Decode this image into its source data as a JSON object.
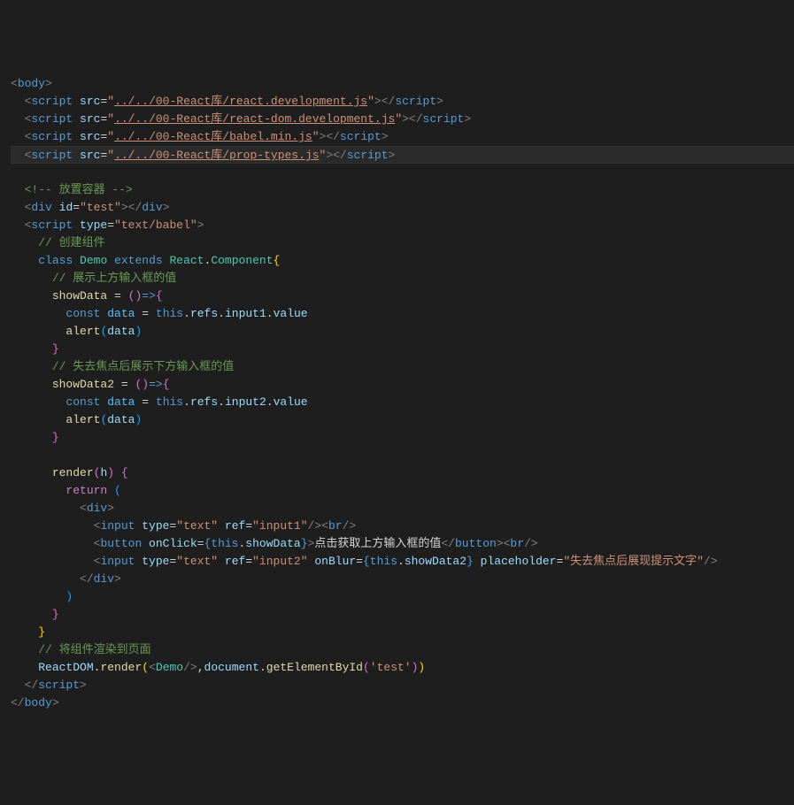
{
  "lines": [
    {
      "segments": [
        {
          "c": "gray",
          "t": "<"
        },
        {
          "c": "tag",
          "t": "body"
        },
        {
          "c": "gray",
          "t": ">"
        }
      ]
    },
    {
      "segments": [
        {
          "c": "punct",
          "t": "  "
        },
        {
          "c": "gray",
          "t": "<"
        },
        {
          "c": "tag",
          "t": "script "
        },
        {
          "c": "attr",
          "t": "src"
        },
        {
          "c": "op",
          "t": "="
        },
        {
          "c": "str",
          "t": "\""
        },
        {
          "c": "str-u",
          "t": "../../00-React库/react.development.js"
        },
        {
          "c": "str",
          "t": "\""
        },
        {
          "c": "gray",
          "t": "></"
        },
        {
          "c": "tag",
          "t": "script"
        },
        {
          "c": "gray",
          "t": ">"
        }
      ]
    },
    {
      "segments": [
        {
          "c": "punct",
          "t": "  "
        },
        {
          "c": "gray",
          "t": "<"
        },
        {
          "c": "tag",
          "t": "script "
        },
        {
          "c": "attr",
          "t": "src"
        },
        {
          "c": "op",
          "t": "="
        },
        {
          "c": "str",
          "t": "\""
        },
        {
          "c": "str-u",
          "t": "../../00-React库/react-dom.development.js"
        },
        {
          "c": "str",
          "t": "\""
        },
        {
          "c": "gray",
          "t": "></"
        },
        {
          "c": "tag",
          "t": "script"
        },
        {
          "c": "gray",
          "t": ">"
        }
      ]
    },
    {
      "segments": [
        {
          "c": "punct",
          "t": "  "
        },
        {
          "c": "gray",
          "t": "<"
        },
        {
          "c": "tag",
          "t": "script "
        },
        {
          "c": "attr",
          "t": "src"
        },
        {
          "c": "op",
          "t": "="
        },
        {
          "c": "str",
          "t": "\""
        },
        {
          "c": "str-u",
          "t": "../../00-React库/babel.min.js"
        },
        {
          "c": "str",
          "t": "\""
        },
        {
          "c": "gray",
          "t": "></"
        },
        {
          "c": "tag",
          "t": "script"
        },
        {
          "c": "gray",
          "t": ">"
        }
      ]
    },
    {
      "highlighted": true,
      "segments": [
        {
          "c": "punct",
          "t": "  "
        },
        {
          "c": "gray",
          "t": "<"
        },
        {
          "c": "tag",
          "t": "script "
        },
        {
          "c": "attr",
          "t": "src"
        },
        {
          "c": "op",
          "t": "="
        },
        {
          "c": "str",
          "t": "\""
        },
        {
          "c": "str-u",
          "t": "../../00-React库/prop-types.js"
        },
        {
          "c": "str",
          "t": "\""
        },
        {
          "c": "gray",
          "t": "></"
        },
        {
          "c": "tag",
          "t": "script"
        },
        {
          "c": "gray",
          "t": ">"
        }
      ]
    },
    {
      "segments": []
    },
    {
      "segments": [
        {
          "c": "punct",
          "t": "  "
        },
        {
          "c": "comment-green",
          "t": "<!-- 放置容器 -->"
        }
      ]
    },
    {
      "segments": [
        {
          "c": "punct",
          "t": "  "
        },
        {
          "c": "gray",
          "t": "<"
        },
        {
          "c": "tag",
          "t": "div "
        },
        {
          "c": "attr",
          "t": "id"
        },
        {
          "c": "op",
          "t": "="
        },
        {
          "c": "str",
          "t": "\"test\""
        },
        {
          "c": "gray",
          "t": "></"
        },
        {
          "c": "tag",
          "t": "div"
        },
        {
          "c": "gray",
          "t": ">"
        }
      ]
    },
    {
      "segments": [
        {
          "c": "punct",
          "t": "  "
        },
        {
          "c": "gray",
          "t": "<"
        },
        {
          "c": "tag",
          "t": "script "
        },
        {
          "c": "attr",
          "t": "type"
        },
        {
          "c": "op",
          "t": "="
        },
        {
          "c": "str",
          "t": "\"text/babel\""
        },
        {
          "c": "gray",
          "t": ">"
        }
      ]
    },
    {
      "segments": [
        {
          "c": "punct",
          "t": "    "
        },
        {
          "c": "comment-green",
          "t": "// 创建组件"
        }
      ]
    },
    {
      "segments": [
        {
          "c": "punct",
          "t": "    "
        },
        {
          "c": "keyword-blue",
          "t": "class"
        },
        {
          "c": "punct",
          "t": " "
        },
        {
          "c": "class-name",
          "t": "Demo"
        },
        {
          "c": "punct",
          "t": " "
        },
        {
          "c": "keyword-blue",
          "t": "extends"
        },
        {
          "c": "punct",
          "t": " "
        },
        {
          "c": "class-name",
          "t": "React"
        },
        {
          "c": "punct",
          "t": "."
        },
        {
          "c": "class-name",
          "t": "Component"
        },
        {
          "c": "brace",
          "t": "{"
        }
      ]
    },
    {
      "segments": [
        {
          "c": "punct",
          "t": "      "
        },
        {
          "c": "comment-green",
          "t": "// 展示上方输入框的值"
        }
      ]
    },
    {
      "segments": [
        {
          "c": "punct",
          "t": "      "
        },
        {
          "c": "fn",
          "t": "showData"
        },
        {
          "c": "punct",
          "t": " "
        },
        {
          "c": "op",
          "t": "="
        },
        {
          "c": "punct",
          "t": " "
        },
        {
          "c": "brace-purple",
          "t": "()"
        },
        {
          "c": "keyword-blue",
          "t": "=>"
        },
        {
          "c": "brace-purple",
          "t": "{"
        }
      ]
    },
    {
      "segments": [
        {
          "c": "punct",
          "t": "        "
        },
        {
          "c": "keyword-blue",
          "t": "const"
        },
        {
          "c": "punct",
          "t": " "
        },
        {
          "c": "const",
          "t": "data"
        },
        {
          "c": "punct",
          "t": " "
        },
        {
          "c": "op",
          "t": "="
        },
        {
          "c": "punct",
          "t": " "
        },
        {
          "c": "keyword-blue",
          "t": "this"
        },
        {
          "c": "punct",
          "t": "."
        },
        {
          "c": "var",
          "t": "refs"
        },
        {
          "c": "punct",
          "t": "."
        },
        {
          "c": "var",
          "t": "input1"
        },
        {
          "c": "punct",
          "t": "."
        },
        {
          "c": "var",
          "t": "value"
        }
      ]
    },
    {
      "segments": [
        {
          "c": "punct",
          "t": "        "
        },
        {
          "c": "fn",
          "t": "alert"
        },
        {
          "c": "brace-blue",
          "t": "("
        },
        {
          "c": "var",
          "t": "data"
        },
        {
          "c": "brace-blue",
          "t": ")"
        }
      ]
    },
    {
      "segments": [
        {
          "c": "punct",
          "t": "      "
        },
        {
          "c": "brace-purple",
          "t": "}"
        }
      ]
    },
    {
      "segments": [
        {
          "c": "punct",
          "t": "      "
        },
        {
          "c": "comment-green",
          "t": "// 失去焦点后展示下方输入框的值"
        }
      ]
    },
    {
      "segments": [
        {
          "c": "punct",
          "t": "      "
        },
        {
          "c": "fn",
          "t": "showData2"
        },
        {
          "c": "punct",
          "t": " "
        },
        {
          "c": "op",
          "t": "="
        },
        {
          "c": "punct",
          "t": " "
        },
        {
          "c": "brace-purple",
          "t": "()"
        },
        {
          "c": "keyword-blue",
          "t": "=>"
        },
        {
          "c": "brace-purple",
          "t": "{"
        }
      ]
    },
    {
      "segments": [
        {
          "c": "punct",
          "t": "        "
        },
        {
          "c": "keyword-blue",
          "t": "const"
        },
        {
          "c": "punct",
          "t": " "
        },
        {
          "c": "const",
          "t": "data"
        },
        {
          "c": "punct",
          "t": " "
        },
        {
          "c": "op",
          "t": "="
        },
        {
          "c": "punct",
          "t": " "
        },
        {
          "c": "keyword-blue",
          "t": "this"
        },
        {
          "c": "punct",
          "t": "."
        },
        {
          "c": "var",
          "t": "refs"
        },
        {
          "c": "punct",
          "t": "."
        },
        {
          "c": "var",
          "t": "input2"
        },
        {
          "c": "punct",
          "t": "."
        },
        {
          "c": "var",
          "t": "value"
        }
      ]
    },
    {
      "segments": [
        {
          "c": "punct",
          "t": "        "
        },
        {
          "c": "fn",
          "t": "alert"
        },
        {
          "c": "brace-blue",
          "t": "("
        },
        {
          "c": "var",
          "t": "data"
        },
        {
          "c": "brace-blue",
          "t": ")"
        }
      ]
    },
    {
      "segments": [
        {
          "c": "punct",
          "t": "      "
        },
        {
          "c": "brace-purple",
          "t": "}"
        }
      ]
    },
    {
      "segments": []
    },
    {
      "segments": [
        {
          "c": "punct",
          "t": "      "
        },
        {
          "c": "fn",
          "t": "render"
        },
        {
          "c": "brace-purple",
          "t": "("
        },
        {
          "c": "var",
          "t": "h"
        },
        {
          "c": "brace-purple",
          "t": ")"
        },
        {
          "c": "punct",
          "t": " "
        },
        {
          "c": "brace-purple",
          "t": "{"
        }
      ]
    },
    {
      "segments": [
        {
          "c": "punct",
          "t": "        "
        },
        {
          "c": "keyword-purple",
          "t": "return"
        },
        {
          "c": "punct",
          "t": " "
        },
        {
          "c": "brace-blue",
          "t": "("
        }
      ]
    },
    {
      "segments": [
        {
          "c": "punct",
          "t": "          "
        },
        {
          "c": "gray",
          "t": "<"
        },
        {
          "c": "tag",
          "t": "div"
        },
        {
          "c": "gray",
          "t": ">"
        }
      ]
    },
    {
      "segments": [
        {
          "c": "punct",
          "t": "            "
        },
        {
          "c": "gray",
          "t": "<"
        },
        {
          "c": "tag",
          "t": "input "
        },
        {
          "c": "attr",
          "t": "type"
        },
        {
          "c": "op",
          "t": "="
        },
        {
          "c": "str",
          "t": "\"text\""
        },
        {
          "c": "punct",
          "t": " "
        },
        {
          "c": "attr",
          "t": "ref"
        },
        {
          "c": "op",
          "t": "="
        },
        {
          "c": "str",
          "t": "\"input1\""
        },
        {
          "c": "gray",
          "t": "/><"
        },
        {
          "c": "tag",
          "t": "br"
        },
        {
          "c": "gray",
          "t": "/>"
        }
      ]
    },
    {
      "segments": [
        {
          "c": "punct",
          "t": "            "
        },
        {
          "c": "gray",
          "t": "<"
        },
        {
          "c": "tag",
          "t": "button "
        },
        {
          "c": "attr",
          "t": "onClick"
        },
        {
          "c": "op",
          "t": "="
        },
        {
          "c": "keyword-blue",
          "t": "{"
        },
        {
          "c": "keyword-blue",
          "t": "this"
        },
        {
          "c": "punct",
          "t": "."
        },
        {
          "c": "var",
          "t": "showData"
        },
        {
          "c": "keyword-blue",
          "t": "}"
        },
        {
          "c": "gray",
          "t": ">"
        },
        {
          "c": "punct",
          "t": "点击获取上方输入框的值"
        },
        {
          "c": "gray",
          "t": "</"
        },
        {
          "c": "tag",
          "t": "button"
        },
        {
          "c": "gray",
          "t": "><"
        },
        {
          "c": "tag",
          "t": "br"
        },
        {
          "c": "gray",
          "t": "/>"
        }
      ]
    },
    {
      "segments": [
        {
          "c": "punct",
          "t": "            "
        },
        {
          "c": "gray",
          "t": "<"
        },
        {
          "c": "tag",
          "t": "input "
        },
        {
          "c": "attr",
          "t": "type"
        },
        {
          "c": "op",
          "t": "="
        },
        {
          "c": "str",
          "t": "\"text\""
        },
        {
          "c": "punct",
          "t": " "
        },
        {
          "c": "attr",
          "t": "ref"
        },
        {
          "c": "op",
          "t": "="
        },
        {
          "c": "str",
          "t": "\"input2\""
        },
        {
          "c": "punct",
          "t": " "
        },
        {
          "c": "attr",
          "t": "onBlur"
        },
        {
          "c": "op",
          "t": "="
        },
        {
          "c": "keyword-blue",
          "t": "{"
        },
        {
          "c": "keyword-blue",
          "t": "this"
        },
        {
          "c": "punct",
          "t": "."
        },
        {
          "c": "var",
          "t": "showData2"
        },
        {
          "c": "keyword-blue",
          "t": "}"
        },
        {
          "c": "punct",
          "t": " "
        },
        {
          "c": "attr",
          "t": "placeholder"
        },
        {
          "c": "op",
          "t": "="
        },
        {
          "c": "str",
          "t": "\"失去焦点后展现提示文字\""
        },
        {
          "c": "gray",
          "t": "/>"
        }
      ]
    },
    {
      "segments": [
        {
          "c": "punct",
          "t": "          "
        },
        {
          "c": "gray",
          "t": "</"
        },
        {
          "c": "tag",
          "t": "div"
        },
        {
          "c": "gray",
          "t": ">"
        }
      ]
    },
    {
      "segments": [
        {
          "c": "punct",
          "t": "        "
        },
        {
          "c": "brace-blue",
          "t": ")"
        }
      ]
    },
    {
      "segments": [
        {
          "c": "punct",
          "t": "      "
        },
        {
          "c": "brace-purple",
          "t": "}"
        }
      ]
    },
    {
      "segments": [
        {
          "c": "punct",
          "t": "    "
        },
        {
          "c": "brace",
          "t": "}"
        }
      ]
    },
    {
      "segments": [
        {
          "c": "punct",
          "t": "    "
        },
        {
          "c": "comment-green",
          "t": "// 将组件渲染到页面"
        }
      ]
    },
    {
      "segments": [
        {
          "c": "punct",
          "t": "    "
        },
        {
          "c": "var",
          "t": "ReactDOM"
        },
        {
          "c": "punct",
          "t": "."
        },
        {
          "c": "fn",
          "t": "render"
        },
        {
          "c": "brace",
          "t": "("
        },
        {
          "c": "gray",
          "t": "<"
        },
        {
          "c": "class-name",
          "t": "Demo"
        },
        {
          "c": "gray",
          "t": "/>"
        },
        {
          "c": "punct",
          "t": ","
        },
        {
          "c": "var",
          "t": "document"
        },
        {
          "c": "punct",
          "t": "."
        },
        {
          "c": "fn",
          "t": "getElementById"
        },
        {
          "c": "brace-purple",
          "t": "("
        },
        {
          "c": "str",
          "t": "'test'"
        },
        {
          "c": "brace-purple",
          "t": ")"
        },
        {
          "c": "brace",
          "t": ")"
        }
      ]
    },
    {
      "segments": [
        {
          "c": "punct",
          "t": "  "
        },
        {
          "c": "gray",
          "t": "</"
        },
        {
          "c": "tag",
          "t": "script"
        },
        {
          "c": "gray",
          "t": ">"
        }
      ]
    },
    {
      "segments": [
        {
          "c": "gray",
          "t": "</"
        },
        {
          "c": "tag",
          "t": "body"
        },
        {
          "c": "gray",
          "t": ">"
        }
      ]
    }
  ]
}
